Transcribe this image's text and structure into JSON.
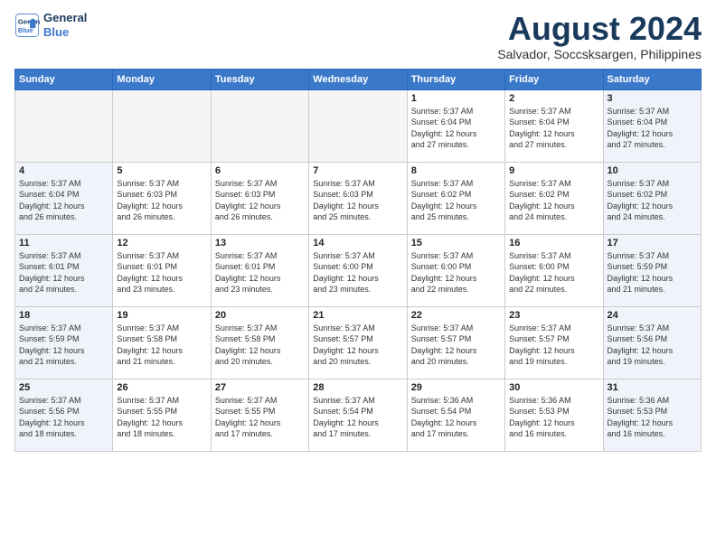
{
  "logo": {
    "line1": "General",
    "line2": "Blue"
  },
  "title": "August 2024",
  "subtitle": "Salvador, Soccsksargen, Philippines",
  "weekdays": [
    "Sunday",
    "Monday",
    "Tuesday",
    "Wednesday",
    "Thursday",
    "Friday",
    "Saturday"
  ],
  "weeks": [
    [
      {
        "day": "",
        "info": ""
      },
      {
        "day": "",
        "info": ""
      },
      {
        "day": "",
        "info": ""
      },
      {
        "day": "",
        "info": ""
      },
      {
        "day": "1",
        "info": "Sunrise: 5:37 AM\nSunset: 6:04 PM\nDaylight: 12 hours\nand 27 minutes."
      },
      {
        "day": "2",
        "info": "Sunrise: 5:37 AM\nSunset: 6:04 PM\nDaylight: 12 hours\nand 27 minutes."
      },
      {
        "day": "3",
        "info": "Sunrise: 5:37 AM\nSunset: 6:04 PM\nDaylight: 12 hours\nand 27 minutes."
      }
    ],
    [
      {
        "day": "4",
        "info": "Sunrise: 5:37 AM\nSunset: 6:04 PM\nDaylight: 12 hours\nand 26 minutes."
      },
      {
        "day": "5",
        "info": "Sunrise: 5:37 AM\nSunset: 6:03 PM\nDaylight: 12 hours\nand 26 minutes."
      },
      {
        "day": "6",
        "info": "Sunrise: 5:37 AM\nSunset: 6:03 PM\nDaylight: 12 hours\nand 26 minutes."
      },
      {
        "day": "7",
        "info": "Sunrise: 5:37 AM\nSunset: 6:03 PM\nDaylight: 12 hours\nand 25 minutes."
      },
      {
        "day": "8",
        "info": "Sunrise: 5:37 AM\nSunset: 6:02 PM\nDaylight: 12 hours\nand 25 minutes."
      },
      {
        "day": "9",
        "info": "Sunrise: 5:37 AM\nSunset: 6:02 PM\nDaylight: 12 hours\nand 24 minutes."
      },
      {
        "day": "10",
        "info": "Sunrise: 5:37 AM\nSunset: 6:02 PM\nDaylight: 12 hours\nand 24 minutes."
      }
    ],
    [
      {
        "day": "11",
        "info": "Sunrise: 5:37 AM\nSunset: 6:01 PM\nDaylight: 12 hours\nand 24 minutes."
      },
      {
        "day": "12",
        "info": "Sunrise: 5:37 AM\nSunset: 6:01 PM\nDaylight: 12 hours\nand 23 minutes."
      },
      {
        "day": "13",
        "info": "Sunrise: 5:37 AM\nSunset: 6:01 PM\nDaylight: 12 hours\nand 23 minutes."
      },
      {
        "day": "14",
        "info": "Sunrise: 5:37 AM\nSunset: 6:00 PM\nDaylight: 12 hours\nand 23 minutes."
      },
      {
        "day": "15",
        "info": "Sunrise: 5:37 AM\nSunset: 6:00 PM\nDaylight: 12 hours\nand 22 minutes."
      },
      {
        "day": "16",
        "info": "Sunrise: 5:37 AM\nSunset: 6:00 PM\nDaylight: 12 hours\nand 22 minutes."
      },
      {
        "day": "17",
        "info": "Sunrise: 5:37 AM\nSunset: 5:59 PM\nDaylight: 12 hours\nand 21 minutes."
      }
    ],
    [
      {
        "day": "18",
        "info": "Sunrise: 5:37 AM\nSunset: 5:59 PM\nDaylight: 12 hours\nand 21 minutes."
      },
      {
        "day": "19",
        "info": "Sunrise: 5:37 AM\nSunset: 5:58 PM\nDaylight: 12 hours\nand 21 minutes."
      },
      {
        "day": "20",
        "info": "Sunrise: 5:37 AM\nSunset: 5:58 PM\nDaylight: 12 hours\nand 20 minutes."
      },
      {
        "day": "21",
        "info": "Sunrise: 5:37 AM\nSunset: 5:57 PM\nDaylight: 12 hours\nand 20 minutes."
      },
      {
        "day": "22",
        "info": "Sunrise: 5:37 AM\nSunset: 5:57 PM\nDaylight: 12 hours\nand 20 minutes."
      },
      {
        "day": "23",
        "info": "Sunrise: 5:37 AM\nSunset: 5:57 PM\nDaylight: 12 hours\nand 19 minutes."
      },
      {
        "day": "24",
        "info": "Sunrise: 5:37 AM\nSunset: 5:56 PM\nDaylight: 12 hours\nand 19 minutes."
      }
    ],
    [
      {
        "day": "25",
        "info": "Sunrise: 5:37 AM\nSunset: 5:56 PM\nDaylight: 12 hours\nand 18 minutes."
      },
      {
        "day": "26",
        "info": "Sunrise: 5:37 AM\nSunset: 5:55 PM\nDaylight: 12 hours\nand 18 minutes."
      },
      {
        "day": "27",
        "info": "Sunrise: 5:37 AM\nSunset: 5:55 PM\nDaylight: 12 hours\nand 17 minutes."
      },
      {
        "day": "28",
        "info": "Sunrise: 5:37 AM\nSunset: 5:54 PM\nDaylight: 12 hours\nand 17 minutes."
      },
      {
        "day": "29",
        "info": "Sunrise: 5:36 AM\nSunset: 5:54 PM\nDaylight: 12 hours\nand 17 minutes."
      },
      {
        "day": "30",
        "info": "Sunrise: 5:36 AM\nSunset: 5:53 PM\nDaylight: 12 hours\nand 16 minutes."
      },
      {
        "day": "31",
        "info": "Sunrise: 5:36 AM\nSunset: 5:53 PM\nDaylight: 12 hours\nand 16 minutes."
      }
    ]
  ]
}
